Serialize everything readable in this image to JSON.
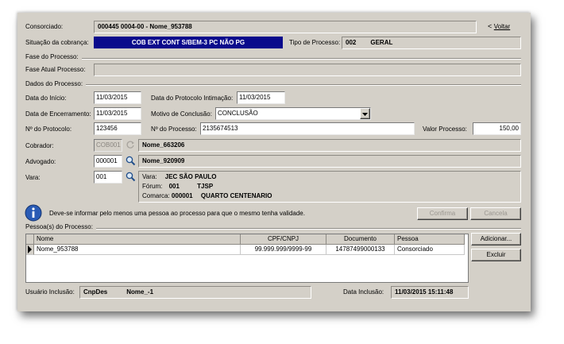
{
  "header": {
    "consorciado_label": "Consorciado:",
    "consorciado_value": "000445 0004-00 - Nome_953788",
    "voltar_label": "Voltar",
    "situacao_label": "Situação da cobrança:",
    "situacao_value": "COB EXT CONT S/BEM-3 PC NÃO PG",
    "tipo_label": "Tipo de Processo:",
    "tipo_code": "002",
    "tipo_value": "GERAL"
  },
  "fase": {
    "section_label": "Fase do Processo:",
    "atual_label": "Fase Atual Processo:",
    "atual_value": ""
  },
  "dados": {
    "section_label": "Dados do Processo:",
    "inicio_label": "Data do Início:",
    "inicio_value": "11/03/2015",
    "protocolo_intimacao_label": "Data do Protocolo Intimação:",
    "protocolo_intimacao_value": "11/03/2015",
    "encerramento_label": "Data de Encerramento:",
    "encerramento_value": "11/03/2015",
    "motivo_label": "Motivo de Conclusão:",
    "motivo_value": "CONCLUSÃO",
    "num_protocolo_label": "Nº do Protocolo:",
    "num_protocolo_value": "123456",
    "num_processo_label": "Nº do Processo:",
    "num_processo_value": "2135674513",
    "valor_label": "Valor Processo:",
    "valor_value": "150,00",
    "cobrador_label": "Cobrador:",
    "cobrador_code": "COB001",
    "cobrador_name": "Nome_663206",
    "advogado_label": "Advogado:",
    "advogado_code": "000001",
    "advogado_name": "Nome_920909",
    "vara_label": "Vara:",
    "vara_code": "001",
    "vara_info": {
      "vara_key": "Vara:",
      "vara_val": "JEC SÃO PAULO",
      "forum_key": "Fórum:",
      "forum_code": "001",
      "forum_val": "TJSP",
      "comarca_key": "Comarca:",
      "comarca_code": "000001",
      "comarca_val": "QUARTO CENTENARIO"
    }
  },
  "info": {
    "message": "Deve-se informar pelo menos uma pessoa ao processo para que o mesmo tenha validade.",
    "confirm_label": "Confirma",
    "cancel_label": "Cancela"
  },
  "pessoas": {
    "section_label": "Pessoa(s) do Processo:",
    "columns": [
      "Nome",
      "CPF/CNPJ",
      "Documento",
      "Pessoa"
    ],
    "rows": [
      [
        "Nome_953788",
        "99.999.999/9999-99",
        "14787499000133",
        "Consorciado"
      ]
    ],
    "add_label": "Adicionar...",
    "delete_label": "Excluir"
  },
  "footer": {
    "usuario_label": "Usuário Inclusão:",
    "usuario_code": "CnpDes",
    "usuario_name": "Nome_-1",
    "data_label": "Data Inclusão:",
    "data_value": "11/03/2015 15:11:48"
  },
  "colors": {
    "window_bg": "#d4d0c8",
    "status_bar_bg": "#0a0a8c",
    "info_icon": "#2a5bb5"
  },
  "icons": [
    "search-icon",
    "refresh-icon",
    "info-icon",
    "dropdown-arrow-icon",
    "row-pointer-icon"
  ]
}
